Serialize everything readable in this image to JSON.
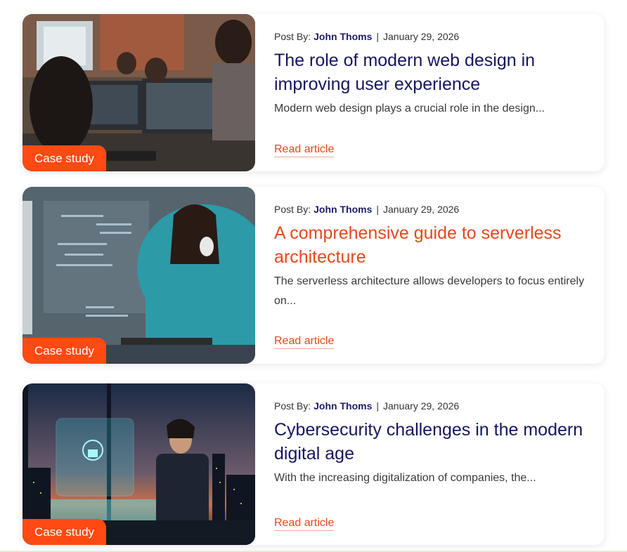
{
  "posts": [
    {
      "badge": "Case study",
      "post_by_label": "Post By:",
      "author": "John Thoms",
      "separator": "|",
      "date": "January 29, 2026",
      "title": "The role of modern web design in improving user experience",
      "excerpt": "Modern web design plays a crucial role in the design...",
      "read_label": "Read article"
    },
    {
      "badge": "Case study",
      "post_by_label": "Post By:",
      "author": "John Thoms",
      "separator": "|",
      "date": "January 29, 2026",
      "title": "A comprehensive guide to serverless architecture",
      "excerpt": "The serverless architecture allows developers to focus entirely on...",
      "read_label": "Read article"
    },
    {
      "badge": "Case study",
      "post_by_label": "Post By:",
      "author": "John Thoms",
      "separator": "|",
      "date": "January 29, 2026",
      "title": "Cybersecurity challenges in the modern digital age",
      "excerpt": "With the increasing digitalization of companies, the...",
      "read_label": "Read article"
    }
  ],
  "colors": {
    "accent": "#ff4a12",
    "title": "#16165e",
    "title_hover": "#e4491c",
    "link": "#e4491c"
  }
}
